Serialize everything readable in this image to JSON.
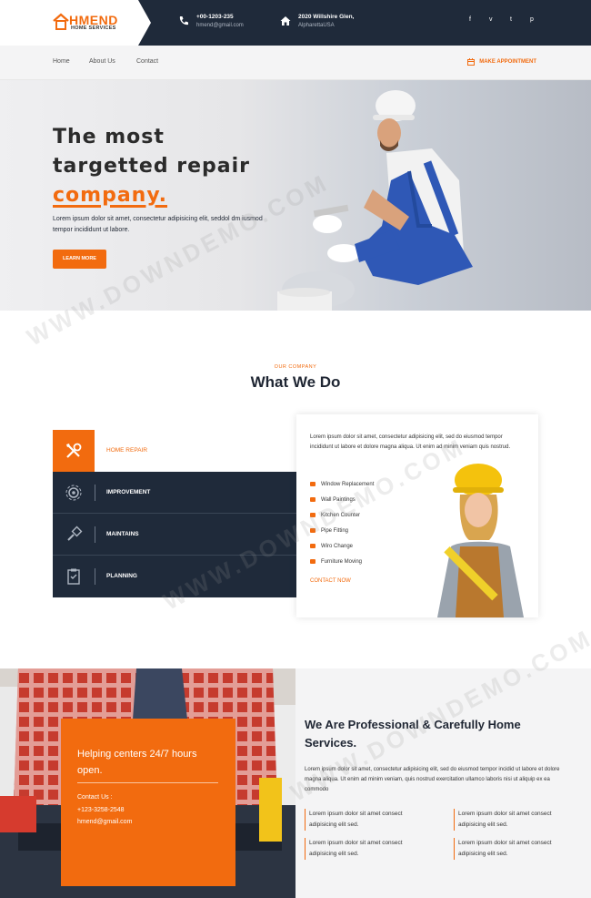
{
  "brand": {
    "name": "HMEND",
    "tagline": "HOME SERVICES",
    "accent": "#f26b0f",
    "dark": "#1f2a3a"
  },
  "topbar": {
    "phone": {
      "line1": "+00-1203-235",
      "line2": "hmend@gmail.com",
      "icon": "phone-icon"
    },
    "address": {
      "line1": "2020 Willshire Glen,",
      "line2": "AlpharettaUSA",
      "icon": "home-icon"
    },
    "social": [
      "f",
      "v",
      "t",
      "p"
    ]
  },
  "nav": {
    "items": [
      "Home",
      "About Us",
      "Contact"
    ],
    "cta": "MAKE APPOINTMENT"
  },
  "hero": {
    "line1": "The most",
    "line2": "targetted repair",
    "accent": "company.",
    "desc": "Lorem ipsum dolor sit amet, consectetur adipisicing elit, seddol dm iusmod tempor incididunt ut labore.",
    "button": "LEARN MORE"
  },
  "services": {
    "eyebrow": "OUR COMPANY",
    "title": "What We Do",
    "tabs": [
      {
        "label": "HOME REPAIR",
        "icon": "tools-icon"
      },
      {
        "label": "IMPROVEMENT",
        "icon": "gear-icon"
      },
      {
        "label": "MAINTAINS",
        "icon": "brush-icon"
      },
      {
        "label": "PLANNING",
        "icon": "clipboard-icon"
      }
    ],
    "panel_text": "Lorem ipsum dolor sit amet, consectetur adipisicing elit, sed do eiusmod tempor incididunt ut labore et dolore magna aliqua. Ut enim ad minim veniam quis nostrud.",
    "list": [
      "Window Replacement",
      "Wall Paintings",
      "Kitchen Counter",
      "Pipe Fitting",
      "Wiro Change",
      "Furniture Moving"
    ],
    "contact": "CONTACT NOW"
  },
  "about": {
    "box_title": "Helping centers 24/7 hours open.",
    "contact_label": "Contact Us :",
    "phone": "+123-3258-2548",
    "email": "hmend@gmail.com",
    "title": "We Are Professional & Carefully Home Services.",
    "text": "Lorem ipsum dolor sit amet, consectetur adipisicing elit, sed do eiusmod tempor incidid ut labore et dolore magna aliqua. Ut enim ad minim veniam, quis nostrud exercitation ullamco laboris nisi ut aliquip ex ea commodo",
    "features": [
      "Lorem ipsum dolor sit amet consect adipisicing elit sed.",
      "Lorem ipsum dolor sit amet consect adipisicing elit sed.",
      "Lorem ipsum dolor sit amet consect adipisicing elit sed.",
      "Lorem ipsum dolor sit amet consect adipisicing elit sed."
    ]
  },
  "watermark": "WWW.DOWNDEMO.COM"
}
